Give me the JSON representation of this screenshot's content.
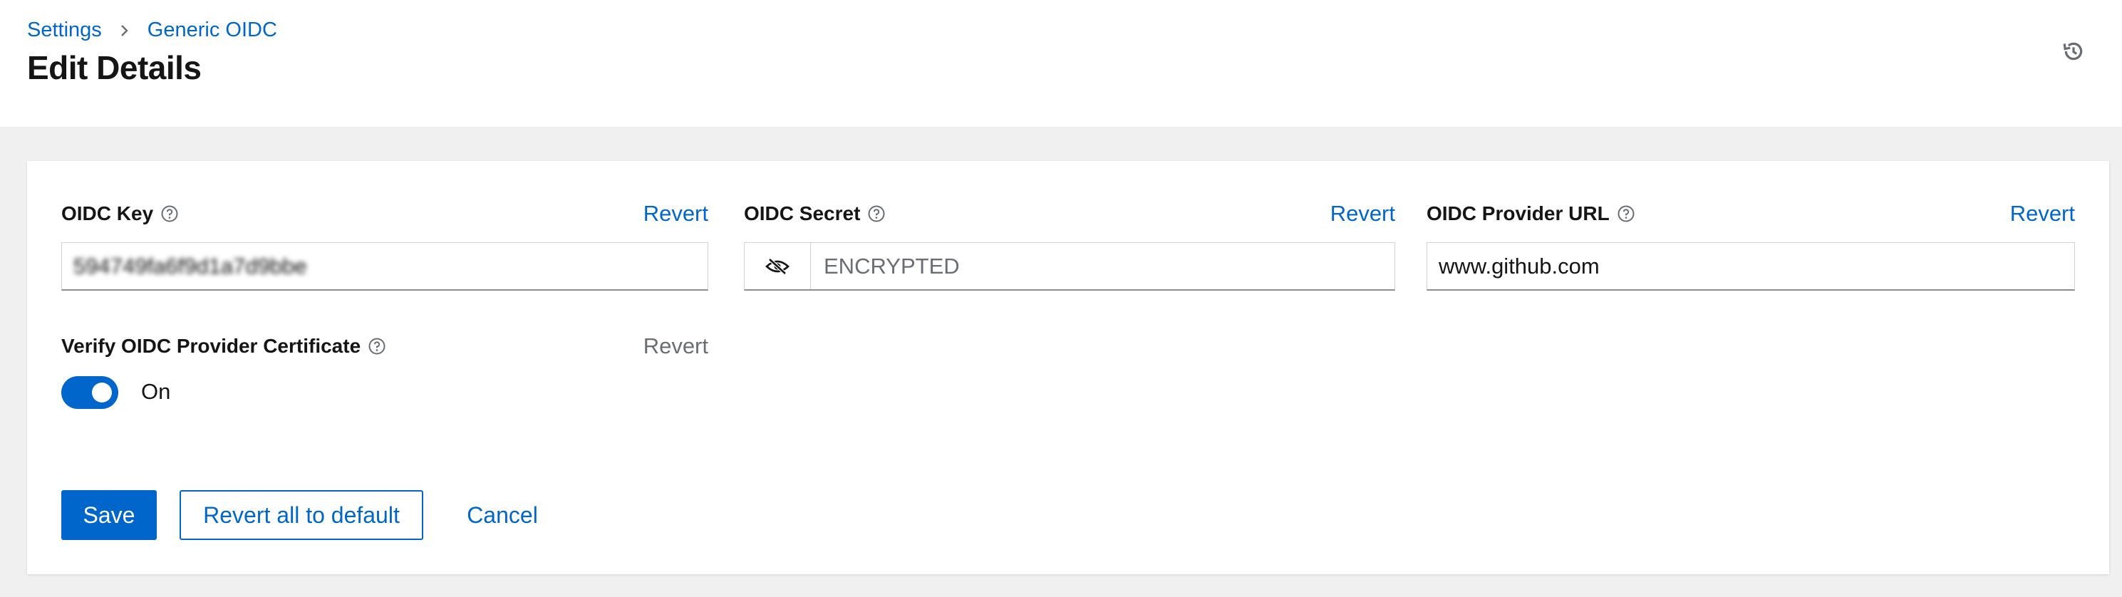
{
  "breadcrumb": {
    "items": [
      "Settings",
      "Generic OIDC"
    ]
  },
  "page": {
    "title": "Edit Details"
  },
  "fields": {
    "oidc_key": {
      "label": "OIDC Key",
      "revert": "Revert",
      "value": "594749fa6f9d1a7d9bbe"
    },
    "oidc_secret": {
      "label": "OIDC Secret",
      "revert": "Revert",
      "placeholder": "ENCRYPTED"
    },
    "oidc_provider_url": {
      "label": "OIDC Provider URL",
      "revert": "Revert",
      "value": "www.github.com"
    },
    "verify_cert": {
      "label": "Verify OIDC Provider Certificate",
      "revert": "Revert",
      "state": "On"
    }
  },
  "actions": {
    "save": "Save",
    "revert_all": "Revert all to default",
    "cancel": "Cancel"
  },
  "icons": {
    "history": "history-icon",
    "help": "help-circle-icon",
    "eye": "eye-slash-icon",
    "separator": "chevron-right-icon"
  },
  "colors": {
    "accent": "#0066cc",
    "background": "#f0f0f0",
    "text": "#151515",
    "muted": "#6a6e73"
  }
}
